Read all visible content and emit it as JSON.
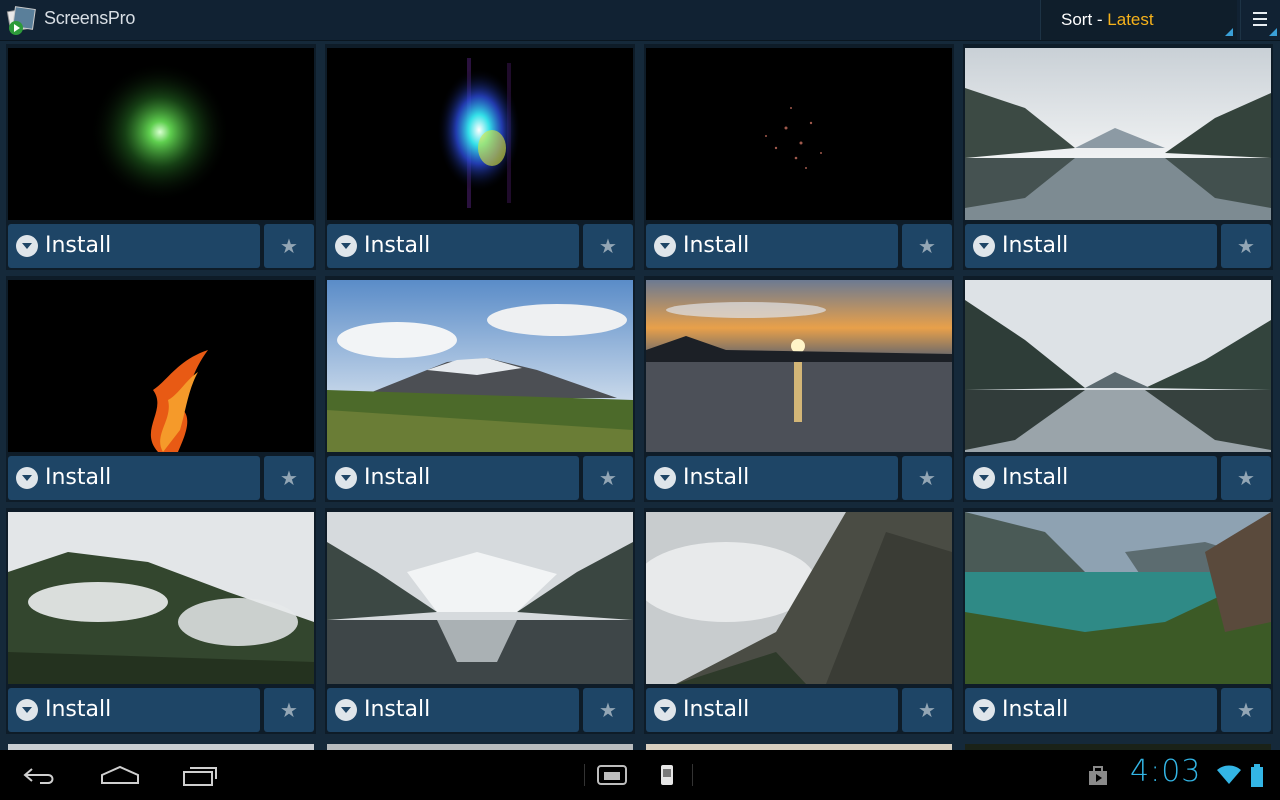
{
  "app": {
    "title": "ScreensPro"
  },
  "sort": {
    "label": "Sort - ",
    "value": "Latest"
  },
  "wallpapers": [
    {
      "install_label": "Install",
      "thumb": "green-particles"
    },
    {
      "install_label": "Install",
      "thumb": "aurora-flame"
    },
    {
      "install_label": "Install",
      "thumb": "dark-sparks"
    },
    {
      "install_label": "Install",
      "thumb": "fjord-clouds"
    },
    {
      "install_label": "Install",
      "thumb": "fire"
    },
    {
      "install_label": "Install",
      "thumb": "snowy-mountain"
    },
    {
      "install_label": "Install",
      "thumb": "sunset-lake"
    },
    {
      "install_label": "Install",
      "thumb": "fjord-reflection"
    },
    {
      "install_label": "Install",
      "thumb": "misty-hills"
    },
    {
      "install_label": "Install",
      "thumb": "snowy-fjord"
    },
    {
      "install_label": "Install",
      "thumb": "cliff-fog"
    },
    {
      "install_label": "Install",
      "thumb": "green-fjord"
    }
  ],
  "status": {
    "time": "4:03"
  },
  "colors": {
    "accent": "#f6b21b",
    "button": "#1e4566",
    "clock": "#33b5e5"
  }
}
